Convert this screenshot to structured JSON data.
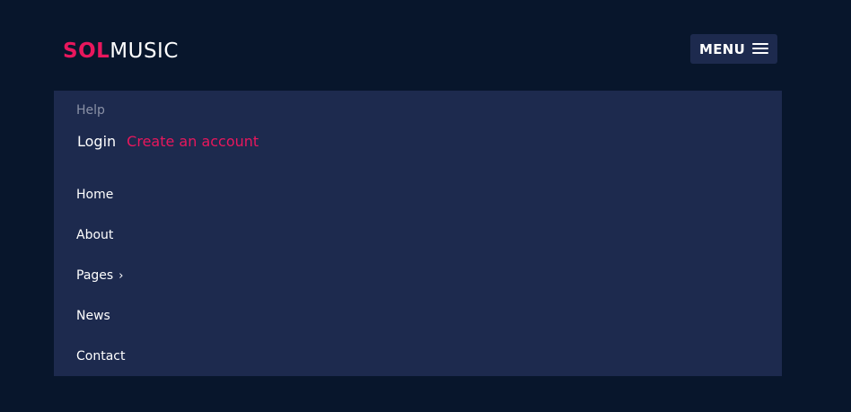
{
  "logo": {
    "part1": "SOL",
    "part2": "MUSIC"
  },
  "menu_button": {
    "label": "MENU",
    "icon": "hamburger-icon"
  },
  "panel": {
    "help": "Help",
    "login": "Login",
    "create_account": "Create an account",
    "nav": [
      {
        "label": "Home"
      },
      {
        "label": "About"
      },
      {
        "label": "Pages",
        "icon": "chevron-right-icon",
        "icon_glyph": "›"
      },
      {
        "label": "News"
      },
      {
        "label": "Contact"
      }
    ]
  },
  "colors": {
    "background": "#08162c",
    "panel": "#1d2a4e",
    "accent": "#e8175d",
    "muted_text": "#8a91a6",
    "text": "#ffffff"
  }
}
